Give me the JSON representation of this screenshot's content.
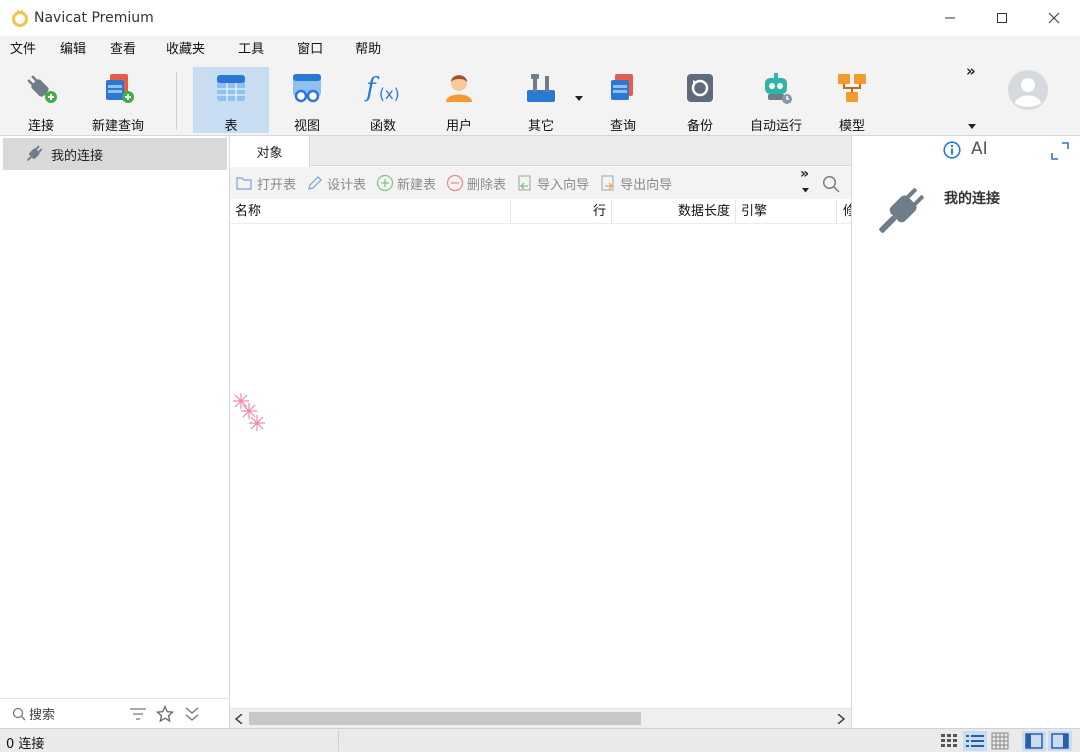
{
  "window": {
    "title": "Navicat Premium"
  },
  "menu": [
    "文件",
    "编辑",
    "查看",
    "收藏夹",
    "工具",
    "窗口",
    "帮助"
  ],
  "toolbar": {
    "connect": "连接",
    "new_query": "新建查询",
    "table": "表",
    "view": "视图",
    "function": "函数",
    "user": "用户",
    "other": "其它",
    "query": "查询",
    "backup": "备份",
    "automation": "自动运行",
    "model": "模型",
    "more": "»"
  },
  "sidebar": {
    "connection_label": "我的连接",
    "search_placeholder": "搜索"
  },
  "main": {
    "tab_label": "对象",
    "actions": {
      "open_table": "打开表",
      "design_table": "设计表",
      "new_table": "新建表",
      "delete_table": "删除表",
      "import_wizard": "导入向导",
      "export_wizard": "导出向导",
      "more": "»"
    },
    "columns": [
      "名称",
      "行",
      "数据长度",
      "引擎",
      "修"
    ]
  },
  "info_panel": {
    "title": "我的连接",
    "ai_label": "AI"
  },
  "status": {
    "connections": "0 连接"
  },
  "colors": {
    "active_tool": "#c8ddf2",
    "accent_blue": "#2a78d4",
    "orange": "#f29a2e",
    "green": "#3cb043"
  }
}
